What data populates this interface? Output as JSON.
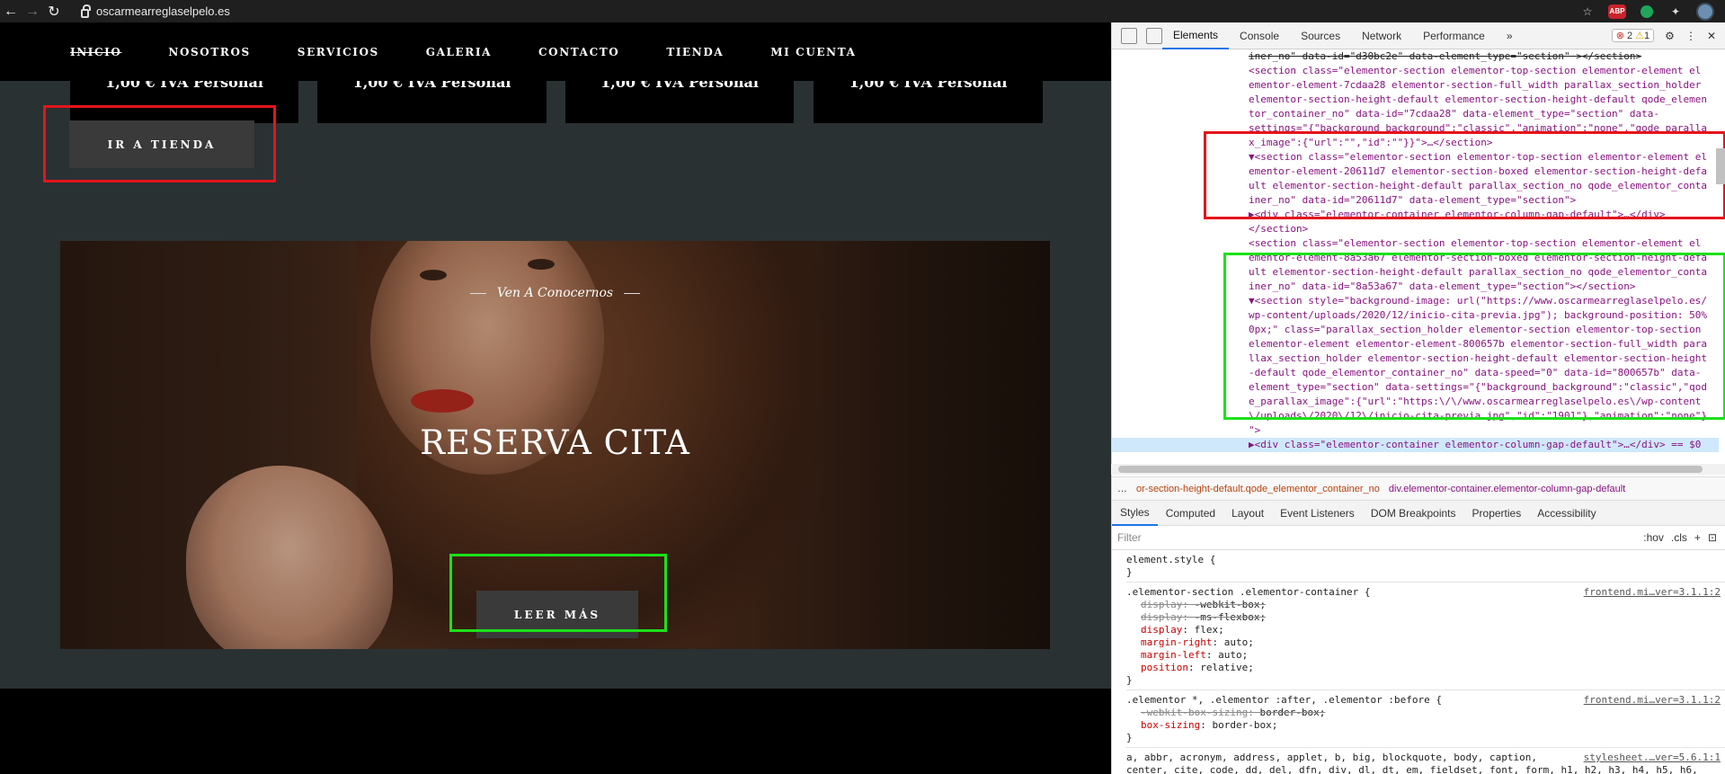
{
  "browser": {
    "url": "oscarmearreglaselpelo.es",
    "back_icon": "arrow-left-icon",
    "forward_icon": "arrow-right-icon",
    "reload_icon": "reload-icon",
    "abp_label": "ABP"
  },
  "site": {
    "nav": [
      "INICIO",
      "NOSOTROS",
      "SERVICIOS",
      "GALERIA",
      "CONTACTO",
      "TIENDA",
      "MI CUENTA"
    ],
    "product_cards": [
      "1,00 € IVA Personal",
      "1,00 € IVA Personal",
      "1,00 € IVA Personal",
      "1,00 € IVA Personal"
    ],
    "shop_button": "IR A TIENDA",
    "hero": {
      "subtitle": "Ven A Conocernos",
      "title": "RESERVA CITA",
      "button": "LEER MÁS"
    }
  },
  "devtools": {
    "tabs": [
      "Elements",
      "Console",
      "Sources",
      "Network",
      "Performance"
    ],
    "more_tabs": "»",
    "errors": "2",
    "warnings": "1",
    "dom_lines": [
      {
        "text": "iner_no\" data-id=\"d30bc2e\" data-element_type=\"section\" ></section>",
        "kind": "cut"
      },
      {
        "text": "<section class=\"elementor-section elementor-top-section elementor-element el",
        "kind": "tag"
      },
      {
        "text": "ementor-element-7cdaa28 elementor-section-full_width parallax_section_holder",
        "kind": "tag"
      },
      {
        "text": "elementor-section-height-default elementor-section-height-default qode_elemen",
        "kind": "tag"
      },
      {
        "text": "tor_container_no\" data-id=\"7cdaa28\" data-element_type=\"section\" data-",
        "kind": "tag"
      },
      {
        "text": "settings=\"{\"background_background\":\"classic\",\"animation\":\"none\",\"qode_paralla",
        "kind": "tag"
      },
      {
        "text": "x_image\":{\"url\":\"\",\"id\":\"\"}}\">…</section>",
        "kind": "tag"
      },
      {
        "text": "▼<section class=\"elementor-section elementor-top-section elementor-element el",
        "kind": "tag"
      },
      {
        "text": "ementor-element-20611d7 elementor-section-boxed elementor-section-height-defa",
        "kind": "tag"
      },
      {
        "text": "ult elementor-section-height-default parallax_section_no qode_elementor_conta",
        "kind": "tag"
      },
      {
        "text": "iner_no\" data-id=\"20611d7\" data-element_type=\"section\">",
        "kind": "tag"
      },
      {
        "text": "  ▶<div class=\"elementor-container elementor-column-gap-default\">…</div>",
        "kind": "tag"
      },
      {
        "text": "  </section>",
        "kind": "tag"
      },
      {
        "text": "<section class=\"elementor-section elementor-top-section elementor-element el",
        "kind": "tag"
      },
      {
        "text": "ementor-element-8a53a67 elementor-section-boxed elementor-section-height-defa",
        "kind": "tag"
      },
      {
        "text": "ult elementor-section-height-default parallax_section_no qode_elementor_conta",
        "kind": "tag"
      },
      {
        "text": "iner_no\" data-id=\"8a53a67\" data-element_type=\"section\"></section>",
        "kind": "tag"
      },
      {
        "text": "▼<section style=\"background-image: url(\"https://www.oscarmearreglaselpelo.es/",
        "kind": "tag"
      },
      {
        "text": "wp-content/uploads/2020/12/inicio-cita-previa.jpg\"); background-position: 50%",
        "kind": "tag"
      },
      {
        "text": "0px;\" class=\"parallax_section_holder elementor-section elementor-top-section",
        "kind": "tag"
      },
      {
        "text": "elementor-element elementor-element-800657b elementor-section-full_width para",
        "kind": "tag"
      },
      {
        "text": "llax_section_holder elementor-section-height-default elementor-section-height",
        "kind": "tag"
      },
      {
        "text": "-default qode_elementor_container_no\" data-speed=\"0\" data-id=\"800657b\" data-",
        "kind": "tag"
      },
      {
        "text": "element_type=\"section\" data-settings=\"{\"background_background\":\"classic\",\"qod",
        "kind": "tag"
      },
      {
        "text": "e_parallax_image\":{\"url\":\"https:\\/\\/www.oscarmearreglaselpelo.es\\/wp-content",
        "kind": "tag"
      },
      {
        "text": "\\/uploads\\/2020\\/12\\/inicio-cita-previa.jpg\",\"id\":\"1901\"},\"animation\":\"none\"}",
        "kind": "tag"
      },
      {
        "text": "\">",
        "kind": "tag"
      },
      {
        "text": "  ▶<div class=\"elementor-container elementor-column-gap-default\">…</div> == $0",
        "kind": "selected"
      }
    ],
    "breadcrumbs": [
      "…",
      "or-section-height-default.qode_elementor_container_no",
      "div.elementor-container.elementor-column-gap-default"
    ],
    "style_tabs": [
      "Styles",
      "Computed",
      "Layout",
      "Event Listeners",
      "DOM Breakpoints",
      "Properties",
      "Accessibility"
    ],
    "filter_placeholder": "Filter",
    "filter_hov": ":hov",
    "filter_cls": ".cls",
    "rules": [
      {
        "selector": "element.style {",
        "source": "",
        "props": [],
        "close": "}"
      },
      {
        "selector": ".elementor-section .elementor-container {",
        "source": "frontend.mi…ver=3.1.1:2",
        "props": [
          {
            "name": "display",
            "value": "-webkit-box;",
            "strike": true
          },
          {
            "name": "display",
            "value": "-ms-flexbox;",
            "strike": true
          },
          {
            "name": "display",
            "value": "flex;",
            "strike": false
          },
          {
            "name": "margin-right",
            "value": "auto;",
            "strike": false
          },
          {
            "name": "margin-left",
            "value": "auto;",
            "strike": false
          },
          {
            "name": "position",
            "value": "relative;",
            "strike": false
          }
        ],
        "close": "}"
      },
      {
        "selector": ".elementor *, .elementor :after, .elementor :before {",
        "source": "frontend.mi…ver=3.1.1:2",
        "props": [
          {
            "name": "-webkit-box-sizing",
            "value": "border-box;",
            "strike": true
          },
          {
            "name": "box-sizing",
            "value": "border-box;",
            "strike": false
          }
        ],
        "close": "}"
      },
      {
        "selector": "a, abbr, acronym, address, applet, b, big, blockquote, body, caption,",
        "source": "stylesheet.…ver=5.6.1:1",
        "props": [],
        "close": "center, cite, code, dd, del, dfn, div, dl, dt, em, fieldset, font, form, h1, h2, h3, h4, h5, h6,"
      }
    ]
  }
}
